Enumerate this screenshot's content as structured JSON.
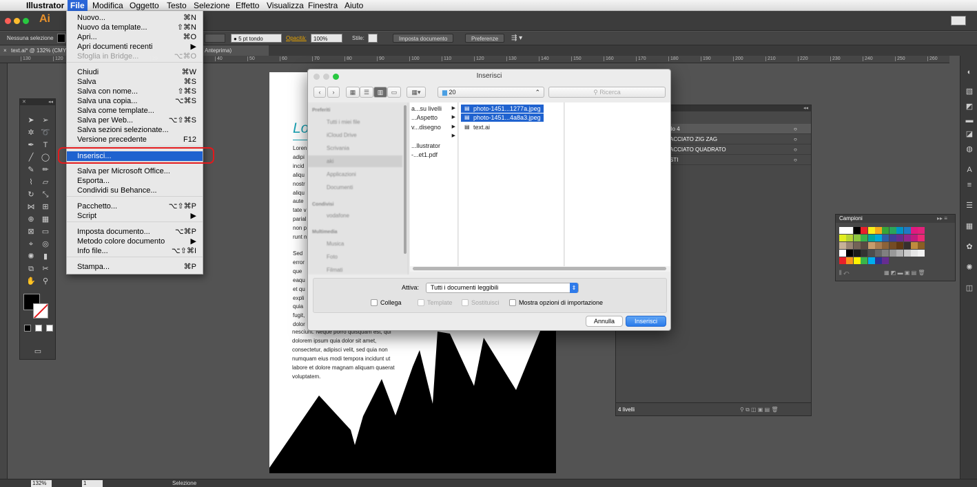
{
  "menubar": {
    "app": "Illustrator",
    "items": [
      "File",
      "Modifica",
      "Oggetto",
      "Testo",
      "Selezione",
      "Effetto",
      "Visualizza",
      "Finestra",
      "Aiuto"
    ]
  },
  "appbar": {
    "logo": "Ai"
  },
  "controlbar": {
    "selection": "Nessuna selezione",
    "stroke_preset": "5 pt tondo",
    "opacity_label": "Opacità:",
    "opacity_value": "100%",
    "style_label": "Stile:",
    "setup_button": "Imposta documento",
    "prefs_button": "Preferenze"
  },
  "doc_tab": {
    "title": "text.ai* @ 132% (CMY",
    "preview": "Anteprima)"
  },
  "ruler": {
    "ticks": [
      "130",
      "120",
      "110",
      "100",
      "20",
      "30",
      "40",
      "50",
      "60",
      "70",
      "80",
      "90",
      "100",
      "110",
      "120",
      "130",
      "140",
      "150",
      "160",
      "170",
      "180",
      "190",
      "200",
      "210",
      "220",
      "230",
      "240",
      "250",
      "260"
    ]
  },
  "file_menu": {
    "items": [
      {
        "label": "Nuovo...",
        "shortcut": "⌘N"
      },
      {
        "label": "Nuovo da template...",
        "shortcut": "⇧⌘N"
      },
      {
        "label": "Apri...",
        "shortcut": "⌘O"
      },
      {
        "label": "Apri documenti recenti",
        "shortcut": "▶"
      },
      {
        "label": "Sfoglia in Bridge...",
        "shortcut": "⌥⌘O"
      },
      {
        "label": "Chiudi",
        "shortcut": "⌘W"
      },
      {
        "label": "Salva",
        "shortcut": "⌘S"
      },
      {
        "label": "Salva con nome...",
        "shortcut": "⇧⌘S"
      },
      {
        "label": "Salva una copia...",
        "shortcut": "⌥⌘S"
      },
      {
        "label": "Salva come template...",
        "shortcut": ""
      },
      {
        "label": "Salva per Web...",
        "shortcut": "⌥⇧⌘S"
      },
      {
        "label": "Salva sezioni selezionate...",
        "shortcut": ""
      },
      {
        "label": "Versione precedente",
        "shortcut": "F12"
      },
      {
        "label": "Inserisci...",
        "shortcut": "⇧⌘P"
      },
      {
        "label": "Salva per Microsoft Office...",
        "shortcut": ""
      },
      {
        "label": "Esporta...",
        "shortcut": ""
      },
      {
        "label": "Condividi su Behance...",
        "shortcut": ""
      },
      {
        "label": "Pacchetto...",
        "shortcut": "⌥⇧⌘P"
      },
      {
        "label": "Script",
        "shortcut": "▶"
      },
      {
        "label": "Imposta documento...",
        "shortcut": "⌥⌘P"
      },
      {
        "label": "Metodo colore documento",
        "shortcut": "▶"
      },
      {
        "label": "Info file...",
        "shortcut": "⌥⇧⌘I"
      },
      {
        "label": "Stampa...",
        "shortcut": "⌘P"
      }
    ]
  },
  "dialog": {
    "title": "Inserisci",
    "folder": "20",
    "search_placeholder": "Ricerca",
    "sidebar": {
      "favorites_heading": "Preferiti",
      "favorites": [
        "Tutti i miei file",
        "iCloud Drive",
        "Scrivania",
        "aki",
        "Applicazioni",
        "Documenti"
      ],
      "devices_heading": "Condivisi",
      "devices": [
        "vodafone"
      ],
      "media_heading": "Multimedia",
      "media": [
        "Musica",
        "Foto",
        "Filmati"
      ]
    },
    "column2": [
      "a...su livelli",
      "...Aspetto",
      "v...disegno",
      "",
      "...llustrator",
      "-...et1.pdf"
    ],
    "column3": [
      "photo-1451...1277a.jpeg",
      "photo-1451...4a8a3.jpeg",
      "text.ai"
    ],
    "enable_label": "Attiva:",
    "enable_value": "Tutti i documenti leggibili",
    "options": [
      "Collega",
      "Template",
      "Sostituisci",
      "Mostra opzioni di importazione"
    ],
    "cancel": "Annulla",
    "confirm": "Inserisci"
  },
  "artboard_text": {
    "heading": "Lo",
    "para1": [
      "Loren",
      "adipi",
      "incid",
      "aliqu",
      "nostr",
      "aliqu",
      "aute",
      "tate v",
      "parial",
      "non p",
      "runt n"
    ],
    "para2": [
      "Sed",
      "error",
      "que",
      "eaqu",
      "et qu",
      "expli",
      "quia",
      "fugit,",
      "dolor"
    ],
    "full_lines": [
      "nesciunt. Neque porro quisquam est, qui",
      "dolorem ipsum quia dolor sit amet,",
      "consectetur, adipisci velit, sed quia non",
      "numquam eius modi tempora incidunt ut",
      "labore et dolore magnam aliquam quaerat",
      "voluptatem."
    ]
  },
  "layers": {
    "rows": [
      "llo 4",
      "ACCIATO ZIG ZAG",
      "ACCIATO QUADRATO",
      "STI"
    ],
    "count": "4 livelli"
  },
  "swatches": {
    "title": "Campioni"
  },
  "status": {
    "zoom": "132%",
    "page": "1",
    "mode": "Selezione"
  },
  "colors": {
    "accent_teal": "#1aa3b5",
    "menu_highlight": "#1f62cf",
    "annotation_ring": "#e3191c"
  }
}
